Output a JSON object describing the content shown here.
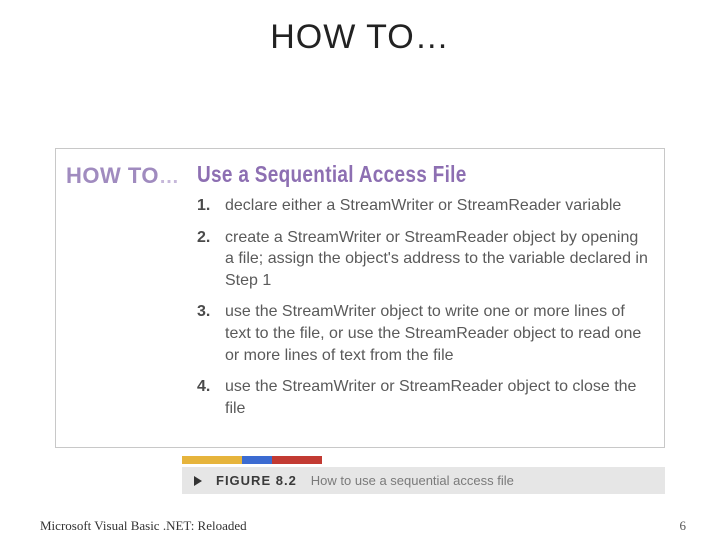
{
  "title": "HOW TO…",
  "howto_label": "HOW TO",
  "howto_dots": "…",
  "subtitle": "Use a Sequential Access File",
  "steps": [
    "declare either a StreamWriter or StreamReader variable",
    "create a StreamWriter or StreamReader object by opening a file; assign the object's address to the variable declared in Step 1",
    "use the StreamWriter object to write one or more lines of text to the file, or use the StreamReader object to read one or more lines of text from the file",
    "use the StreamWriter or StreamReader object to close the file"
  ],
  "figure": {
    "label": "FIGURE 8.2",
    "description": "How to use a sequential access file"
  },
  "footer": {
    "left": "Microsoft Visual Basic .NET: Reloaded",
    "right": "6"
  },
  "colors": {
    "accent_purple": "#8d6fb2",
    "accent_purple_light": "#a08bbf",
    "bar_yellow": "#e6b43c",
    "bar_blue": "#3b6bd1",
    "bar_red": "#c23a32"
  }
}
